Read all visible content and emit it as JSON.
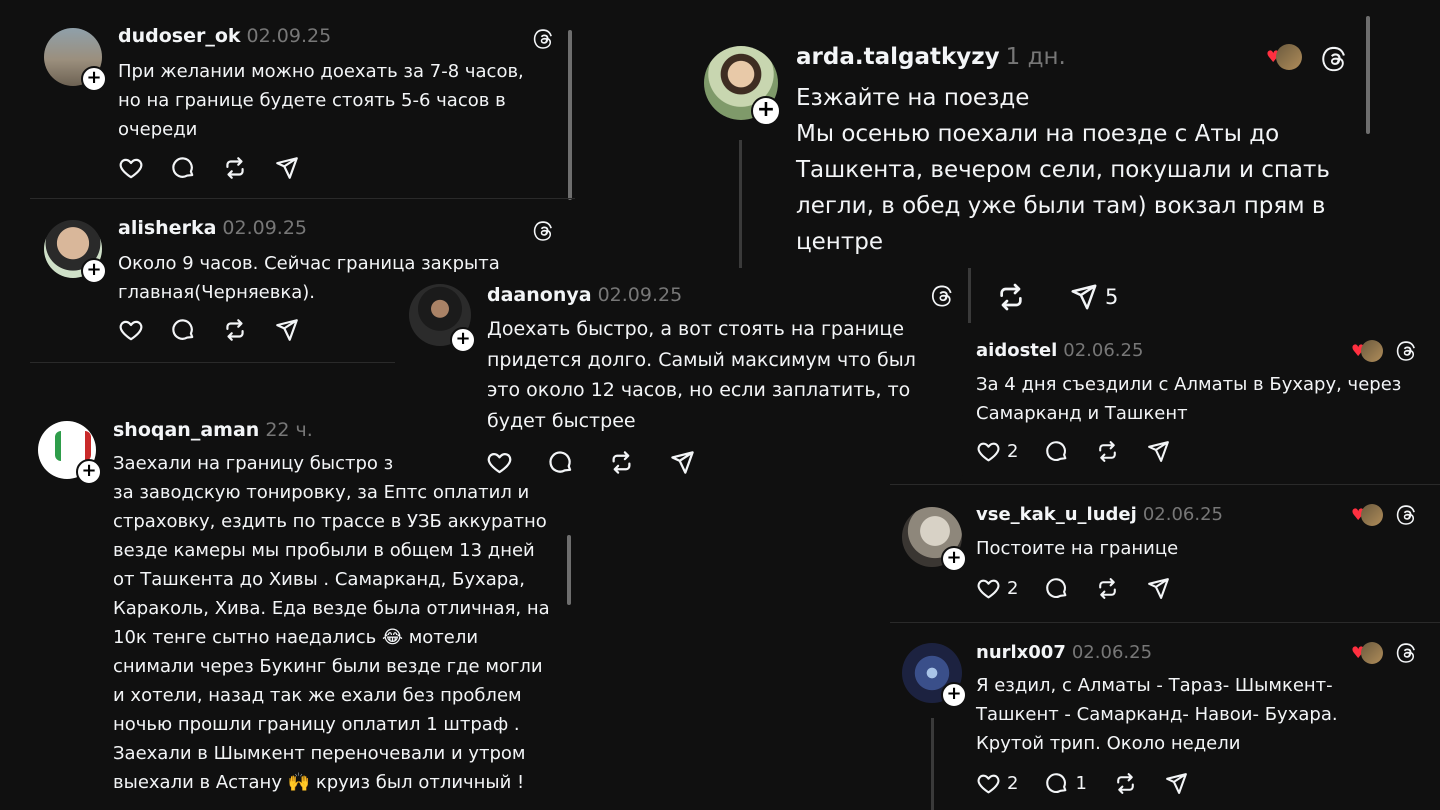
{
  "posts": [
    {
      "username": "dudoser_ok",
      "date": "02.09.25",
      "text": "При желании можно доехать за 7-8 часов,\nно на границе будете стоять 5-6 часов в\nочереди",
      "likes": "",
      "replies": ""
    },
    {
      "username": "alisherka",
      "date": "02.09.25",
      "text": "Около 9 часов. Сейчас граница закрыта\nглавная(Черняевка).",
      "likes": "",
      "replies": ""
    },
    {
      "username": "shoqan_aman",
      "date": "22 ч.",
      "text": "Заехали на границу быстро з\nза заводскую тонировку, за Ептс оплатил и\nстраховку, ездить по трассе в УЗБ аккуратно\nвезде камеры мы пробыли в общем 13 дней\nот Ташкента до Хивы . Самарканд, Бухара,\nКараколь, Хива. Еда везде была отличная, на\n10к тенге сытно наедались 😂 мотели\nснимали через Букинг были везде где могли\nи хотели, назад так же ехали без проблем\nночью прошли границу оплатил 1 штраф .\nЗаехали в Шымкент переночевали и утром\nвыехали в Астану 🙌 круиз был отличный !"
    },
    {
      "username": "arda.talgatkyzy",
      "date": "1 дн.",
      "text": "Езжайте на поезде\nМы осенью поехали на поезде с Аты до\nТашкента, вечером сели, покушали и спать\nлегли, в обед уже были там) вокзал прям в\nцентре",
      "shares": "5"
    },
    {
      "username": "daanonya",
      "date": "02.09.25",
      "text": "Доехать быстро, а вот стоять на границе\nпридется долго. Самый максимум что был\nэто около 12 часов, но если заплатить, то\nбудет быстрее"
    },
    {
      "username": "aidostel",
      "date": "02.06.25",
      "text": "За 4 дня съездили с Алматы в Бухару, через\nСамарканд и Ташкент",
      "likes": "2"
    },
    {
      "username": "vse_kak_u_ludej",
      "date": "02.06.25",
      "text": "Постоите на границе",
      "likes": "2"
    },
    {
      "username": "nurlx007",
      "date": "02.06.25",
      "text": "Я ездил, с Алматы - Тараз- Шымкент-\nТашкент - Самарканд- Навои- Бухара.\nКрутой трип. Около недели",
      "likes": "2",
      "replies": "1"
    }
  ],
  "icons": {
    "like": "heart-icon",
    "reply": "comment-icon",
    "repost": "repost-icon",
    "share": "share-icon",
    "threads": "threads-logo-icon"
  },
  "colors": {
    "background": "#101010",
    "text": "#f3f5f7",
    "muted": "#777777",
    "heart": "#ff3040"
  }
}
